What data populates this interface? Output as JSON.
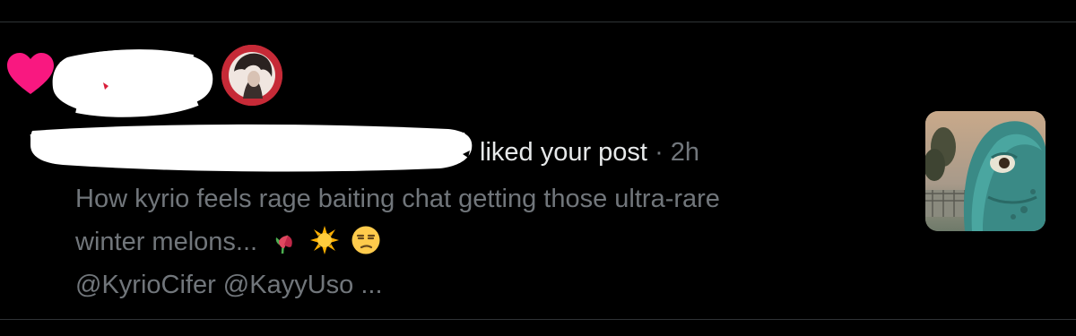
{
  "notification": {
    "action_text": "liked your post",
    "separator": "·",
    "time": "2h",
    "post_line1": "How kyrio feels rage baiting chat getting those ultra-rare",
    "post_line2": "winter melons...",
    "post_line3": "@KyrioCifer @KayyUso ...",
    "emojis": [
      "wilted-flower-emoji",
      "sun-emoji",
      "unamused-face-emoji"
    ]
  },
  "icons": {
    "like": "heart-icon"
  },
  "colors": {
    "background": "#000000",
    "heart": "#f91880",
    "primary_text": "#e7e9ea",
    "secondary_text": "#71767b",
    "divider": "#2f3336"
  }
}
